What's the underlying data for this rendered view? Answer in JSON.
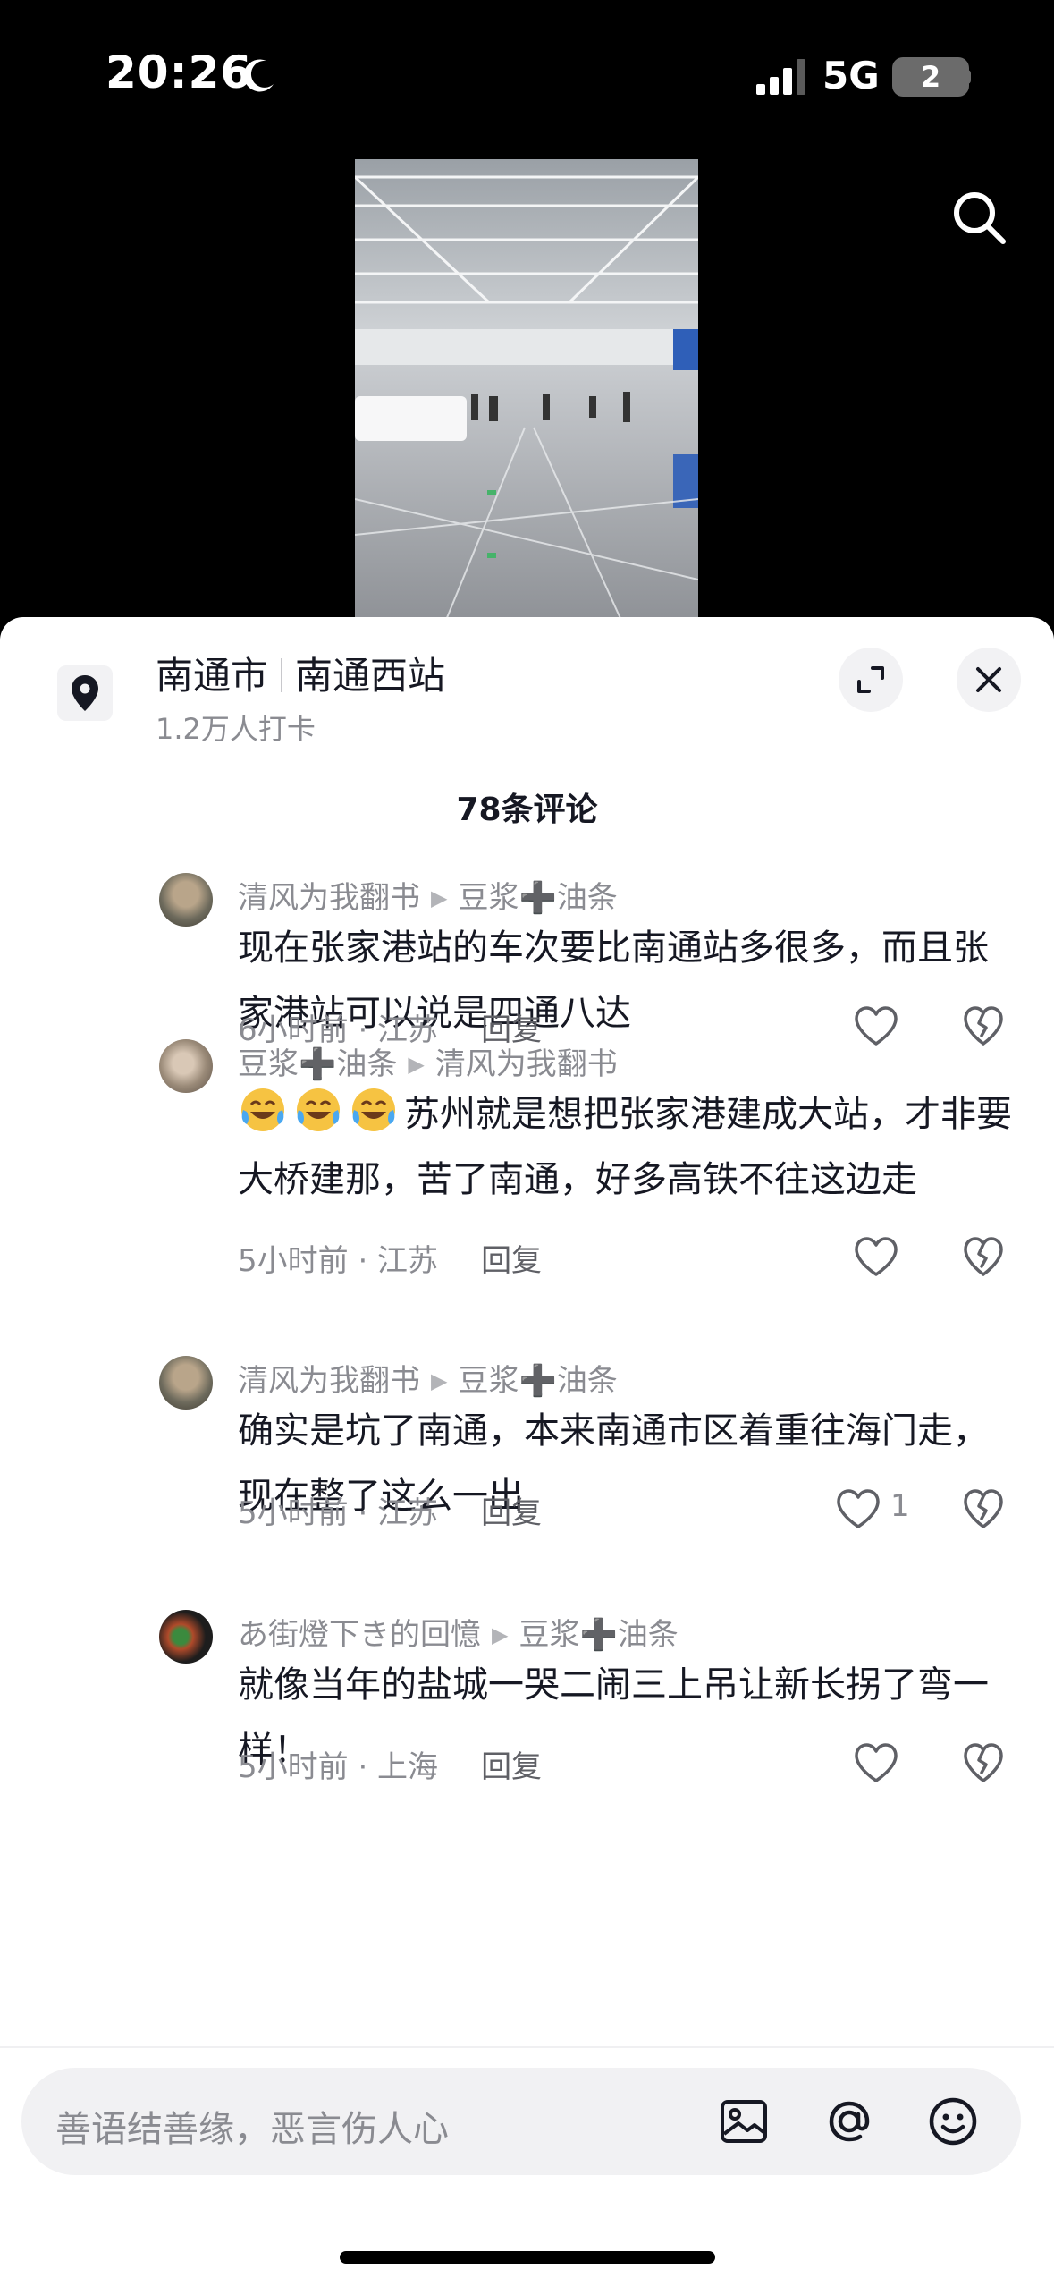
{
  "status_bar": {
    "time": "20:26",
    "network": "5G",
    "battery": "2"
  },
  "location": {
    "city": "南通市",
    "place": "南通西站",
    "checkins": "1.2万人打卡"
  },
  "comment_count": "78条评论",
  "comments": [
    {
      "author": "清风为我翻书",
      "reply_to_a": "豆浆",
      "reply_to_plus": "➕",
      "reply_to_b": "油条",
      "text": "现在张家港站的车次要比南通站多很多，而且张家港站可以说是四通八达",
      "time_loc": "6小时前 · 江苏",
      "reply_label": "回复",
      "likes": ""
    },
    {
      "author_a": "豆浆",
      "author_plus": "➕",
      "author_b": "油条",
      "reply_to": "清风为我翻书",
      "emoji": "face-with-tears-of-joy",
      "text": "苏州就是想把张家港建成大站，才非要大桥建那，苦了南通，好多高铁不往这边走",
      "time_loc": "5小时前 · 江苏",
      "reply_label": "回复",
      "likes": ""
    },
    {
      "author": "清风为我翻书",
      "reply_to_a": "豆浆",
      "reply_to_plus": "➕",
      "reply_to_b": "油条",
      "text": "确实是坑了南通，本来南通市区着重往海门走，现在整了这么一出",
      "time_loc": "5小时前 · 江苏",
      "reply_label": "回复",
      "likes": "1"
    },
    {
      "author": "あ街燈下き的回憶",
      "reply_to_a": "豆浆",
      "reply_to_plus": "➕",
      "reply_to_b": "油条",
      "text": "就像当年的盐城一哭二闹三上吊让新长拐了弯一样！",
      "time_loc": "5小时前 · 上海",
      "reply_label": "回复",
      "likes": ""
    }
  ],
  "input": {
    "placeholder": "善语结善缘，恶言伤人心"
  },
  "icons": [
    "moon-icon",
    "signal-icon",
    "search-icon",
    "location-pin-icon",
    "expand-icon",
    "close-icon",
    "heart-icon",
    "broken-heart-icon",
    "image-icon",
    "at-icon",
    "emoji-icon"
  ]
}
